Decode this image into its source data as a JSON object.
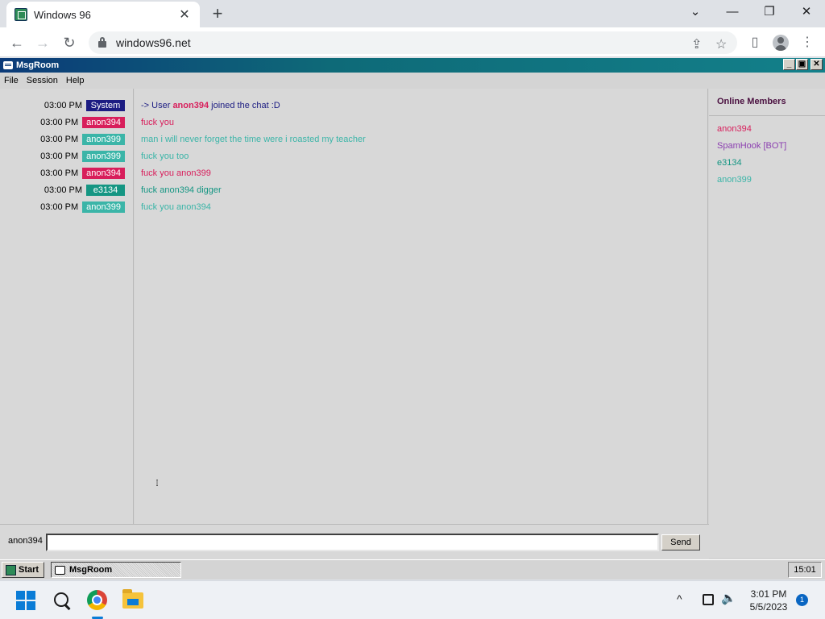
{
  "browser": {
    "tab_title": "Windows 96",
    "tab_close": "✕",
    "new_tab": "+",
    "url": "windows96.net",
    "controls": {
      "chevron": "⌄",
      "minimize": "—",
      "restore": "❐",
      "close": "✕"
    },
    "nav": {
      "back": "←",
      "forward": "→",
      "reload": "↻"
    },
    "toolbar_icons": {
      "share": "⇪",
      "bookmark": "☆",
      "sidepanel": "▯",
      "menu": "⋮"
    }
  },
  "app": {
    "title": "MsgRoom",
    "window_buttons": {
      "minimize": "_",
      "maximize": "▣",
      "close": "✕"
    },
    "menu": [
      "File",
      "Session",
      "Help"
    ],
    "messages": [
      {
        "time": "03:00 PM",
        "user": "System",
        "user_color": "#1c1c82",
        "text": "",
        "text_color": "#1c1c82",
        "system": true,
        "sys_prefix": "-> User ",
        "sys_user": "anon394",
        "sys_suffix": " joined the chat :D",
        "sys_user_color": "#d81e5b"
      },
      {
        "time": "03:00 PM",
        "user": "anon394",
        "user_color": "#d81e5b",
        "text": "fuck you",
        "text_color": "#d81e5b"
      },
      {
        "time": "03:00 PM",
        "user": "anon399",
        "user_color": "#3bb5a8",
        "text": "man i will never forget the time were i roasted my teacher",
        "text_color": "#3bb5a8"
      },
      {
        "time": "03:00 PM",
        "user": "anon399",
        "user_color": "#3bb5a8",
        "text": "fuck you too",
        "text_color": "#3bb5a8"
      },
      {
        "time": "03:00 PM",
        "user": "anon394",
        "user_color": "#d81e5b",
        "text": "fuck you anon399",
        "text_color": "#d81e5b"
      },
      {
        "time": "03:00 PM",
        "user": "e3134",
        "user_color": "#159683",
        "text": "fuck anon394 digger",
        "text_color": "#159683"
      },
      {
        "time": "03:00 PM",
        "user": "anon399",
        "user_color": "#3bb5a8",
        "text": "fuck you anon394",
        "text_color": "#3bb5a8"
      }
    ],
    "online": {
      "header": "Online Members",
      "members": [
        {
          "name": "anon394",
          "color": "#d81e5b"
        },
        {
          "name": "SpamHook [BOT]",
          "color": "#8b3fb0"
        },
        {
          "name": "e3134",
          "color": "#159683"
        },
        {
          "name": "anon399",
          "color": "#3bb5a8"
        }
      ]
    },
    "input": {
      "name": "anon394",
      "value": "",
      "placeholder": "",
      "send_label": "Send"
    }
  },
  "w96_taskbar": {
    "start_label": "Start",
    "task_label": "MsgRoom",
    "clock": "15:01"
  },
  "win_taskbar": {
    "time": "3:01 PM",
    "date": "5/5/2023",
    "notification_count": "1",
    "chevron": "^",
    "volume": "🔈"
  }
}
